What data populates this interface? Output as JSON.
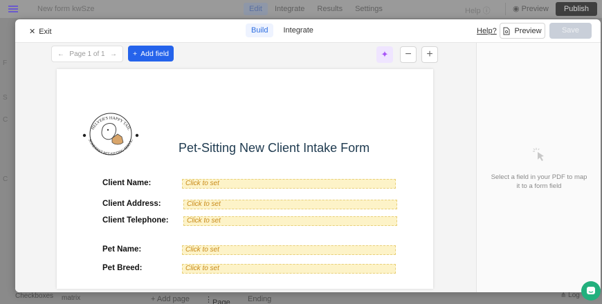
{
  "background": {
    "file_name": "New form kwSze",
    "nav": [
      "Edit",
      "Integrate",
      "Results",
      "Settings"
    ],
    "help": "Help",
    "preview": "Preview",
    "publish": "Publish",
    "left_letters": [
      "F",
      "S",
      "C",
      "C"
    ],
    "bottom": {
      "checkboxes": "Checkboxes",
      "matrix": "matrix",
      "add_page": "+ Add page",
      "page": "Page",
      "ending": "Ending",
      "log": "Log"
    }
  },
  "modal": {
    "exit_label": "Exit",
    "tabs": [
      "Build",
      "Integrate"
    ],
    "help_label": "Help?",
    "preview_label": "Preview",
    "save_label": "Save"
  },
  "toolbar": {
    "page_indicator": "Page 1 of 1",
    "add_field_label": "Add field"
  },
  "right_panel": {
    "hint": "Select a field in your PDF to map it to a form field"
  },
  "pdf": {
    "title": "Pet-Sitting New Client Intake Form",
    "logo_text_top": "HELVER'S HAPPY TAILS",
    "logo_text_bottom": "SOMERSET PET-SITTING SERVICES",
    "fields": [
      {
        "label": "Client Name:",
        "value": "Click to set"
      },
      {
        "label": "Client Address:",
        "value": "Click to set"
      },
      {
        "label": "Client Telephone:",
        "value": "Click to set"
      },
      {
        "label": "Pet Name:",
        "value": "Click to set"
      },
      {
        "label": "Pet Breed:",
        "value": "Click to set"
      }
    ]
  },
  "colors": {
    "primary": "#2563eb",
    "field_fill": "#fdf3c8",
    "field_text": "#c88a1a",
    "title": "#1e3a4f",
    "chat": "#22b07d"
  }
}
